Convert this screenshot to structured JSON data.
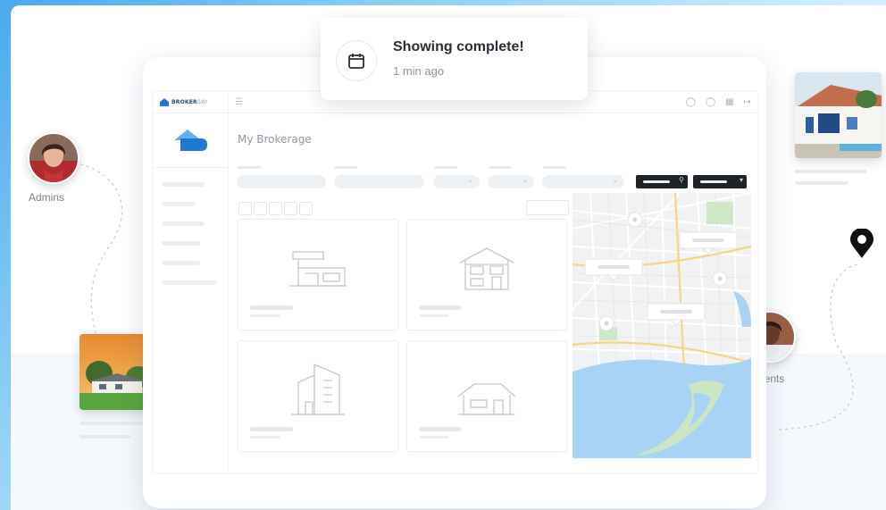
{
  "brand": {
    "name_bold": "BROKER",
    "name_light": "BAY"
  },
  "topbar": {
    "menu_icon": "hamburger-icon",
    "icons": [
      "bell-icon",
      "chat-icon",
      "grid-icon",
      "logout-icon"
    ]
  },
  "page": {
    "title": "My Brokerage"
  },
  "notification": {
    "title": "Showing complete!",
    "time": "1 min ago",
    "icon": "calendar-icon"
  },
  "people": [
    {
      "label": "Admins",
      "icon": "admin-avatar"
    },
    {
      "label": "Agents",
      "icon": "agent-avatar"
    }
  ],
  "colors": {
    "brand_blue": "#1f78d1",
    "logo_light_blue": "#5fb3ee",
    "dark_button": "#1f2327",
    "map_water": "#a9d3f5",
    "map_land": "#f1f2f4",
    "map_park": "#cfe8c7"
  }
}
